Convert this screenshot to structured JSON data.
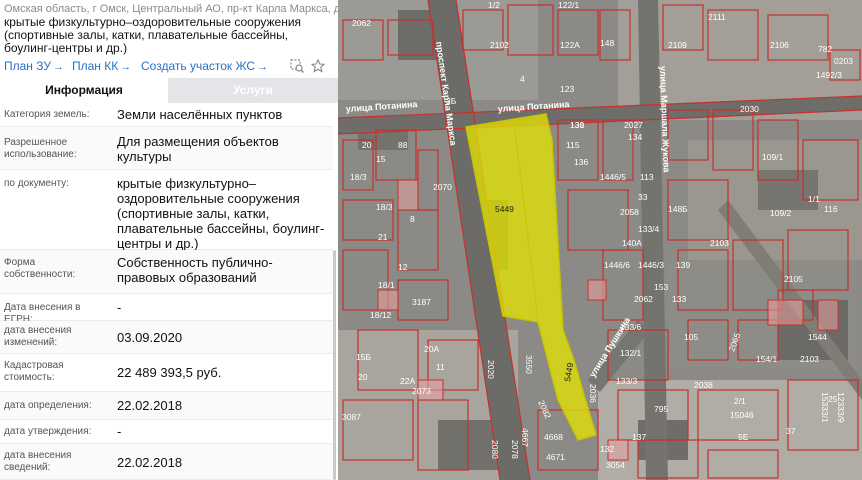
{
  "header": {
    "address": "Омская область, г Омск, Центральный АО, пр-кт Карла Маркса, д 37",
    "purpose": "крытые физкультурно–оздоровительные сооружения (спортивные залы, катки, плавательные бассейны, боулинг-центры и др.)"
  },
  "links": {
    "plan_zu": "План ЗУ",
    "plan_kk": "План КК",
    "create_zhs": "Создать участок ЖС",
    "arrow": "→"
  },
  "tabs": {
    "info": "Информация",
    "services": "Услуги"
  },
  "attributes": [
    {
      "key": "Категория земель:",
      "value": "Земли населённых пунктов"
    },
    {
      "key": "Разрешенное использование:",
      "value": "Для размещения объектов культуры"
    },
    {
      "key": "по документу:",
      "value": "крытые физкультурно–оздоровительные сооружения (спортивные залы, катки, плавательные бассейны, боулинг-центры и др.)"
    },
    {
      "key": "Форма собственности:",
      "value": "Собственность публично-правовых образований"
    },
    {
      "key": "Дата внесения в ЕГРН:",
      "value": "-"
    },
    {
      "key": "дата внесения изменений:",
      "value": "03.09.2020"
    },
    {
      "key": "Кадастровая стоимость:",
      "value": "22 489 393,5 руб."
    },
    {
      "key": "дата определения:",
      "value": "22.02.2018"
    },
    {
      "key": "дата утверждения:",
      "value": "-"
    },
    {
      "key": "дата внесения сведений:",
      "value": "22.02.2018"
    }
  ],
  "map": {
    "streets": {
      "karla_marksa": "проспект Карла Маркса",
      "potanina": "улица Потанина",
      "potanina2": "улица Потанина",
      "marshala_zhukova": "улица Маршала Жукова",
      "pushkina": "улица Пушкина"
    },
    "highlight_label_1": "5449",
    "highlight_label_2": "5449",
    "plot_labels": [
      "2062",
      "1/2",
      "122/1",
      "2111",
      "2106",
      "782",
      "0203",
      "122А",
      "2109",
      "1492/3",
      "2102",
      "148",
      "123",
      "4",
      "2027",
      "2030",
      "109/1",
      "88",
      "115",
      "20",
      "2058",
      "2070",
      "131",
      "1446/5",
      "134",
      "133/4",
      "130",
      "18/3",
      "15",
      "18/3",
      "109/2",
      "116",
      "148Б",
      "2103",
      "1/1",
      "21",
      "12",
      "18/1",
      "8",
      "136",
      "1446/6",
      "33",
      "140А",
      "113",
      "2105",
      "139",
      "1446/3",
      "3187",
      "18/12",
      "133/6",
      "2062",
      "133",
      "153",
      "15Б",
      "22А",
      "2073",
      "20А",
      "2020",
      "3550",
      "2080",
      "1544",
      "2036",
      "132/1",
      "133/3",
      "105",
      "2065",
      "154/1",
      "2103",
      "2038",
      "11",
      "20",
      "795",
      "15046",
      "25",
      "3087",
      "2082",
      "4667",
      "4668",
      "4671",
      "3054",
      "132",
      "137",
      "37",
      "3Б",
      "15333/1",
      "12333/9",
      "5Е",
      "2078",
      "2/1"
    ]
  }
}
